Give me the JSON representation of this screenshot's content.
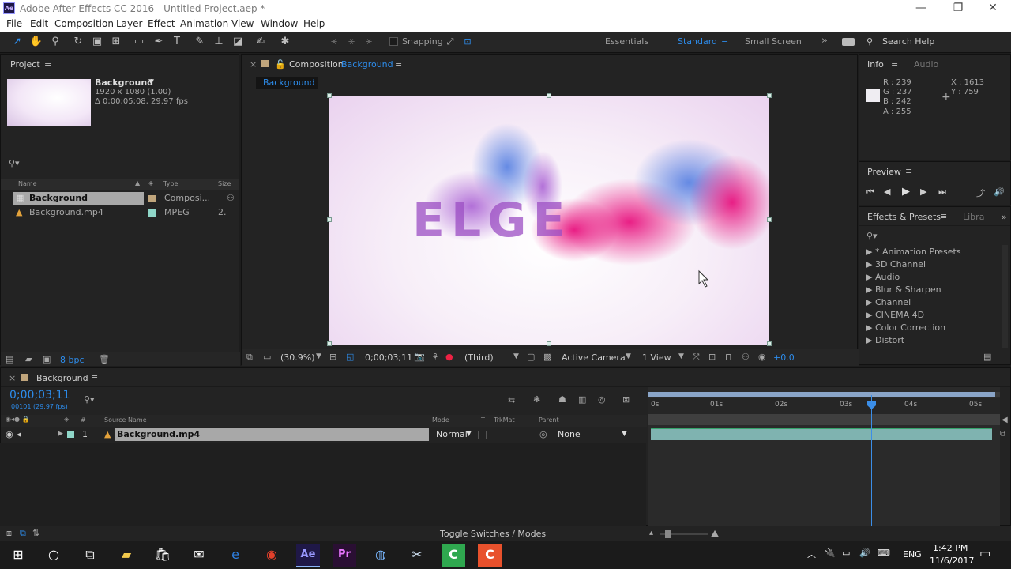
{
  "app": {
    "title": "Adobe After Effects CC 2016 - Untitled Project.aep *",
    "icon": "ae-logo-icon"
  },
  "window_controls": {
    "minimize": "—",
    "maximize": "❐",
    "close": "✕"
  },
  "menu": [
    "File",
    "Edit",
    "Composition",
    "Layer",
    "Effect",
    "Animation",
    "View",
    "Window",
    "Help"
  ],
  "toolbar": {
    "snapping": "Snapping",
    "workspaces": [
      "Essentials",
      "Standard",
      "Small Screen"
    ],
    "active_workspace": "Standard",
    "search_help": "Search Help",
    "more": "»"
  },
  "project": {
    "title": "Project",
    "comp_name": "Background",
    "comp_size": "1920 x 1080 (1.00)",
    "comp_duration": "Δ 0;00;05;08, 29.97 fps",
    "columns": [
      "Name",
      "Type",
      "Size"
    ],
    "items": [
      {
        "name": "Background",
        "type": "Composi..."
      },
      {
        "name": "Background.mp4",
        "type": "MPEG",
        "size": "2."
      }
    ],
    "bpc": "8 bpc"
  },
  "comp": {
    "label": "Composition",
    "name": "Background",
    "tab": "Background",
    "overlay_text": "ELGE",
    "zoom": "(30.9%)",
    "timecode": "0;00;03;11",
    "resolution": "(Third)",
    "camera": "Active Camera",
    "views": "1 View",
    "exposure": "+0.0"
  },
  "info": {
    "title": "Info",
    "tab2": "Audio",
    "r": "R : 239",
    "g": "G : 237",
    "b": "B : 242",
    "a": "A : 255",
    "x": "X : 1613",
    "y": "Y : 759",
    "swatch": "#efedf2"
  },
  "preview": {
    "title": "Preview"
  },
  "effects": {
    "title": "Effects & Presets",
    "tab2": "Libra",
    "items": [
      "* Animation Presets",
      "3D Channel",
      "Audio",
      "Blur & Sharpen",
      "Channel",
      "CINEMA 4D",
      "Color Correction",
      "Distort"
    ]
  },
  "timeline": {
    "comp_tab": "Background",
    "timecode": "0;00;03;11",
    "frame_info": "00101 (29.97 fps)",
    "columns": {
      "num": "#",
      "source": "Source Name",
      "mode": "Mode",
      "t": "T",
      "trkmat": "TrkMat",
      "parent": "Parent"
    },
    "layer": {
      "index": "1",
      "name": "Background.mp4",
      "mode": "Normal",
      "parent": "None"
    },
    "ruler": [
      "0s",
      "01s",
      "02s",
      "03s",
      "04s",
      "05s"
    ],
    "toggle": "Toggle Switches / Modes",
    "playhead_fraction": 0.636
  },
  "taskbar": {
    "time": "1:42 PM",
    "date": "11/6/2017",
    "lang": "ENG"
  },
  "colors": {
    "accent": "#2d8ceb",
    "ae": "#9999ff",
    "pr": "#ea77ff",
    "bar": "#1b1b1b"
  }
}
